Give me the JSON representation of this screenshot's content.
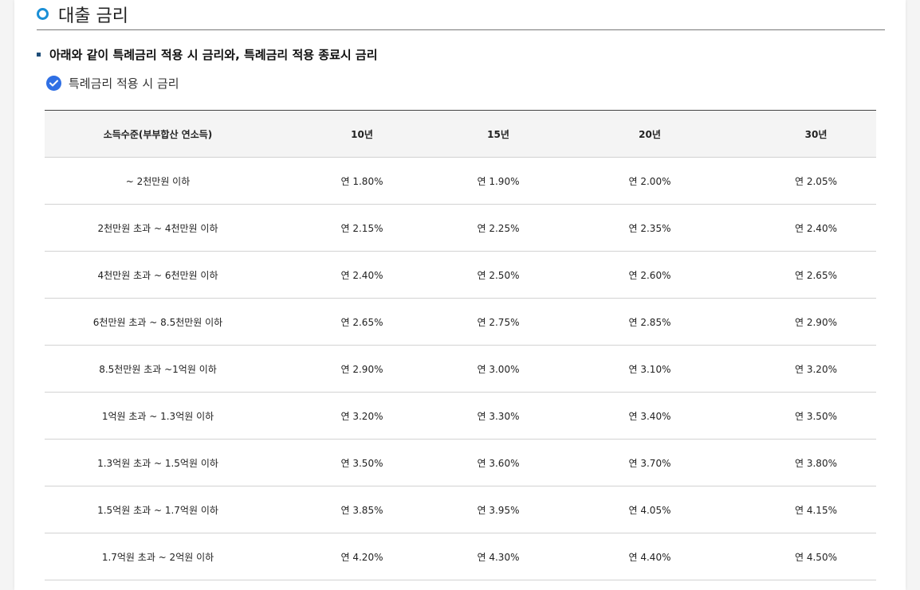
{
  "section": {
    "title": "대출 금리"
  },
  "subheading": "아래와 같이 특례금리 적용 시 금리와, 특례금리 적용 종료시 금리",
  "checked_heading": "특례금리 적용 시 금리",
  "colors": {
    "accent_blue": "#1a8fd6",
    "check_blue": "#2f6fe4",
    "bullet_navy": "#1f4e79",
    "header_bg": "#f4f4f4"
  },
  "table": {
    "headers": [
      "소득수준(부부합산 연소득)",
      "10년",
      "15년",
      "20년",
      "30년"
    ],
    "rows": [
      [
        "~ 2천만원 이하",
        "연 1.80%",
        "연 1.90%",
        "연 2.00%",
        "연 2.05%"
      ],
      [
        "2천만원 초과 ~ 4천만원 이하",
        "연 2.15%",
        "연 2.25%",
        "연 2.35%",
        "연 2.40%"
      ],
      [
        "4천만원 초과 ~ 6천만원 이하",
        "연 2.40%",
        "연 2.50%",
        "연 2.60%",
        "연 2.65%"
      ],
      [
        "6천만원 초과 ~ 8.5천만원 이하",
        "연 2.65%",
        "연 2.75%",
        "연 2.85%",
        "연 2.90%"
      ],
      [
        "8.5천만원 초과 ~1억원 이하",
        "연 2.90%",
        "연 3.00%",
        "연 3.10%",
        "연 3.20%"
      ],
      [
        "1억원 초과 ~ 1.3억원 이하",
        "연 3.20%",
        "연 3.30%",
        "연 3.40%",
        "연 3.50%"
      ],
      [
        "1.3억원 초과 ~ 1.5억원 이하",
        "연 3.50%",
        "연 3.60%",
        "연 3.70%",
        "연 3.80%"
      ],
      [
        "1.5억원 초과 ~ 1.7억원 이하",
        "연 3.85%",
        "연 3.95%",
        "연 4.05%",
        "연 4.15%"
      ],
      [
        "1.7억원 초과 ~ 2억원 이하",
        "연 4.20%",
        "연 4.30%",
        "연 4.40%",
        "연 4.50%"
      ]
    ]
  }
}
